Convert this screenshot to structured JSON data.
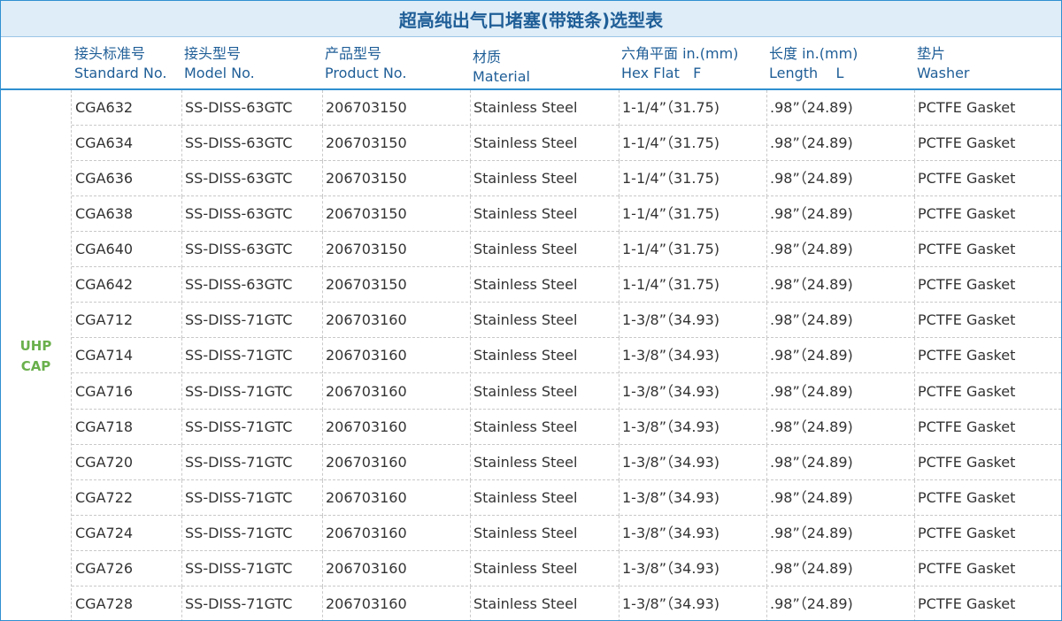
{
  "title": "超高纯出气口堵塞(带链条)选型表",
  "headers": [
    {
      "cn": "接头标准号",
      "en": "Standard No."
    },
    {
      "cn": "接头型号",
      "en": "Model No."
    },
    {
      "cn": "产品型号",
      "en": "Product No."
    },
    {
      "cn": "材质",
      "en": "Material"
    },
    {
      "cn": "六角平面 in.(mm)",
      "en": "Hex Flat   F"
    },
    {
      "cn": "长度 in.(mm)",
      "en": "Length    L"
    },
    {
      "cn": "垫片",
      "en": "Washer"
    }
  ],
  "group": {
    "line1": "UHP",
    "line2": "CAP"
  },
  "rows": [
    [
      "CGA632",
      "SS-DISS-63GTC",
      "206703150",
      "Stainless Steel",
      "1-1/4”（31.75)",
      ".98”（24.89)",
      "PCTFE Gasket"
    ],
    [
      "CGA634",
      "SS-DISS-63GTC",
      "206703150",
      "Stainless Steel",
      "1-1/4”（31.75)",
      ".98”（24.89)",
      "PCTFE Gasket"
    ],
    [
      "CGA636",
      "SS-DISS-63GTC",
      "206703150",
      "Stainless Steel",
      "1-1/4”（31.75)",
      ".98”（24.89)",
      "PCTFE Gasket"
    ],
    [
      "CGA638",
      "SS-DISS-63GTC",
      "206703150",
      "Stainless Steel",
      "1-1/4”（31.75)",
      ".98”（24.89)",
      "PCTFE Gasket"
    ],
    [
      "CGA640",
      "SS-DISS-63GTC",
      "206703150",
      "Stainless Steel",
      "1-1/4”（31.75)",
      ".98”（24.89)",
      "PCTFE Gasket"
    ],
    [
      "CGA642",
      "SS-DISS-63GTC",
      "206703150",
      "Stainless Steel",
      "1-1/4”（31.75)",
      ".98”（24.89)",
      "PCTFE Gasket"
    ],
    [
      "CGA712",
      "SS-DISS-71GTC",
      "206703160",
      "Stainless Steel",
      "1-3/8”（34.93)",
      ".98”（24.89)",
      "PCTFE Gasket"
    ],
    [
      "CGA714",
      "SS-DISS-71GTC",
      "206703160",
      "Stainless Steel",
      "1-3/8”（34.93)",
      ".98”（24.89)",
      "PCTFE Gasket"
    ],
    [
      "CGA716",
      "SS-DISS-71GTC",
      "206703160",
      "Stainless Steel",
      "1-3/8”（34.93)",
      ".98”（24.89)",
      "PCTFE Gasket"
    ],
    [
      "CGA718",
      "SS-DISS-71GTC",
      "206703160",
      "Stainless Steel",
      "1-3/8”（34.93)",
      ".98”（24.89)",
      "PCTFE Gasket"
    ],
    [
      "CGA720",
      "SS-DISS-71GTC",
      "206703160",
      "Stainless Steel",
      "1-3/8”（34.93)",
      ".98”（24.89)",
      "PCTFE Gasket"
    ],
    [
      "CGA722",
      "SS-DISS-71GTC",
      "206703160",
      "Stainless Steel",
      "1-3/8”（34.93)",
      ".98”（24.89)",
      "PCTFE Gasket"
    ],
    [
      "CGA724",
      "SS-DISS-71GTC",
      "206703160",
      "Stainless Steel",
      "1-3/8”（34.93)",
      ".98”（24.89)",
      "PCTFE Gasket"
    ],
    [
      "CGA726",
      "SS-DISS-71GTC",
      "206703160",
      "Stainless Steel",
      "1-3/8”（34.93)",
      ".98”（24.89)",
      "PCTFE Gasket"
    ],
    [
      "CGA728",
      "SS-DISS-71GTC",
      "206703160",
      "Stainless Steel",
      "1-3/8”（34.93)",
      ".98”（24.89)",
      "PCTFE Gasket"
    ]
  ],
  "colors": {
    "title_bg": "#deedf8",
    "header_text": "#1f5e97",
    "group_text": "#6ab04c",
    "rule": "#2f8fd0"
  }
}
